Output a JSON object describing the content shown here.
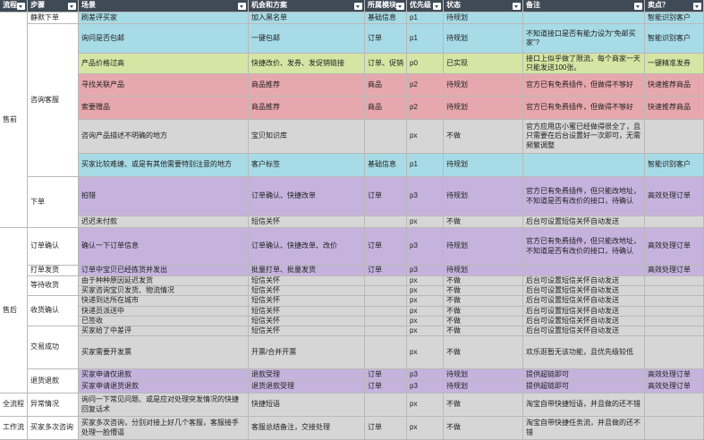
{
  "headers": [
    "流程",
    "步骤",
    "场景",
    "机会和方案",
    "所属模块",
    "优先级",
    "状态",
    "备注",
    "卖点？"
  ],
  "colors": {
    "header": "#3f4a57",
    "cyan": "#a7dbe6",
    "green": "#d5e5a3",
    "red": "#e7a8ad",
    "gray": "#d6d6d6",
    "purple": "#c5b3de"
  },
  "groups": {
    "stages": [
      "售前",
      "售后",
      "全流程",
      "工作流"
    ],
    "steps": [
      "静默下单",
      "咨询客服",
      "下单",
      "订单确认",
      "打单发货",
      "等待收货",
      "收货确认",
      "交易成功",
      "退货退款",
      "异常情况",
      "买家多次咨询"
    ]
  },
  "rows": [
    {
      "scene": "刷差评买家",
      "plan": "加入黑名单",
      "module": "基础信息",
      "priority": "p1",
      "status": "待规划",
      "note": "",
      "selling": "智能识别客户",
      "color": "cyan"
    },
    {
      "scene": "询问是否包邮",
      "plan": "一键包邮",
      "module": "订单",
      "priority": "p1",
      "status": "待规划",
      "note": "不知道接口是否有能力设为“免邮买家”?",
      "selling": "智能识别客户",
      "color": "cyan"
    },
    {
      "scene": "产品价格过高",
      "plan": "快捷改价、发券、发促销链接",
      "module": "订单、促销",
      "priority": "p0",
      "status": "已实现",
      "note": "接口上似乎做了限流，每个商家一天只能发送100张。",
      "selling": "一键精准发券",
      "color": "green"
    },
    {
      "scene": "寻找关联产品",
      "plan": "商品推荐",
      "module": "商品",
      "priority": "p2",
      "status": "待规划",
      "note": "官方已有免费插件，但做得不够好",
      "selling": "快速推荐商品",
      "color": "red"
    },
    {
      "scene": "索要赠品",
      "plan": "商品推荐",
      "module": "商品",
      "priority": "p2",
      "status": "待规划",
      "note": "官方已有免费插件，但做得不够好",
      "selling": "快速推荐商品",
      "color": "red"
    },
    {
      "scene": "咨询产品描述不明确的地方",
      "plan": "宝贝知识库",
      "module": "",
      "priority": "px",
      "status": "不做",
      "note": "官方应用店小蜜已经做得很全了，且只需要在后台设置好一次即可，无需频繁调整",
      "selling": "",
      "color": "gray"
    },
    {
      "scene": "买家比较难缠、或是有其他需要特别注意的地方",
      "plan": "客户标签",
      "module": "基础信息",
      "priority": "p1",
      "status": "待规划",
      "note": "",
      "selling": "智能识别客户",
      "color": "cyan"
    },
    {
      "scene": "拍错",
      "plan": "订单确认、快捷改单",
      "module": "订单",
      "priority": "p3",
      "status": "待规划",
      "note": "官方已有免费插件，但只能改地址，不知道是否有改价的接口，待确认",
      "selling": "高效处理订单",
      "color": "purple"
    },
    {
      "scene": "迟迟未付款",
      "plan": "短信关怀",
      "module": "",
      "priority": "px",
      "status": "不做",
      "note": "后台可设置短信关怀自动发送",
      "selling": "",
      "color": "gray"
    },
    {
      "scene": "确认一下订单信息",
      "plan": "订单确认、快捷改单、改价",
      "module": "订单",
      "priority": "p3",
      "status": "待规划",
      "note": "官方已有免费插件，但只能改地址，不知道是否有改价的接口，待确认",
      "selling": "高效处理订单",
      "color": "purple"
    },
    {
      "scene": "订单中宝贝已经拣货并发出",
      "plan": "批量打单、批量发货",
      "module": "订单",
      "priority": "p3",
      "status": "待规划",
      "note": "",
      "selling": "高效处理订单",
      "color": "purple"
    },
    {
      "scene": "由于种种原因延迟发货",
      "plan": "短信关怀",
      "module": "",
      "priority": "px",
      "status": "不做",
      "note": "后台可设置短信关怀自动发送",
      "selling": "",
      "color": "gray"
    },
    {
      "scene": "买家咨询宝贝发货、物流情况",
      "plan": "短信关怀",
      "module": "",
      "priority": "px",
      "status": "不做",
      "note": "后台可设置短信关怀自动发送",
      "selling": "",
      "color": "gray"
    },
    {
      "scene": "快递到达所在城市",
      "plan": "短信关怀",
      "module": "",
      "priority": "px",
      "status": "不做",
      "note": "后台可设置短信关怀自动发送",
      "selling": "",
      "color": "gray"
    },
    {
      "scene": "快递员派送中",
      "plan": "短信关怀",
      "module": "",
      "priority": "px",
      "status": "不做",
      "note": "后台可设置短信关怀自动发送",
      "selling": "",
      "color": "gray"
    },
    {
      "scene": "已签收",
      "plan": "短信关怀",
      "module": "",
      "priority": "px",
      "status": "不做",
      "note": "后台可设置短信关怀自动发送",
      "selling": "",
      "color": "gray"
    },
    {
      "scene": "买家给了中差评",
      "plan": "短信关怀",
      "module": "",
      "priority": "px",
      "status": "不做",
      "note": "后台可设置短信关怀自动发送",
      "selling": "",
      "color": "gray"
    },
    {
      "scene": "买家需要开发票",
      "plan": "开票/合并开票",
      "module": "",
      "priority": "px",
      "status": "不做",
      "note": "欢乐逛暂无该功能，且优先级较低",
      "selling": "",
      "color": "gray"
    },
    {
      "scene": "买家申请仅退款",
      "plan": "退款受理",
      "module": "订单",
      "priority": "p3",
      "status": "待规划",
      "note": "提供超链即可",
      "selling": "高效处理订单",
      "color": "purple"
    },
    {
      "scene": "买家申请退货退款",
      "plan": "退货退款受理",
      "module": "订单",
      "priority": "p3",
      "status": "待规划",
      "note": "提供超链即可",
      "selling": "高效处理订单",
      "color": "purple"
    },
    {
      "scene": "询问一下常见问题、或是应对处理突发情况的快捷回复话术",
      "plan": "快捷短语",
      "module": "",
      "priority": "px",
      "status": "不做",
      "note": "淘宝自带快捷短语，并且做的还不错",
      "selling": "",
      "color": "gray"
    },
    {
      "scene": "买家多次咨询，分别对接上好几个客服，客服接手处理一脸懵逼",
      "plan": "客服总结备注，交接处理",
      "module": "订单",
      "priority": "px",
      "status": "不做",
      "note": "淘宝自带快捷任务流，并且做的还不错",
      "selling": "",
      "color": "gray"
    }
  ]
}
